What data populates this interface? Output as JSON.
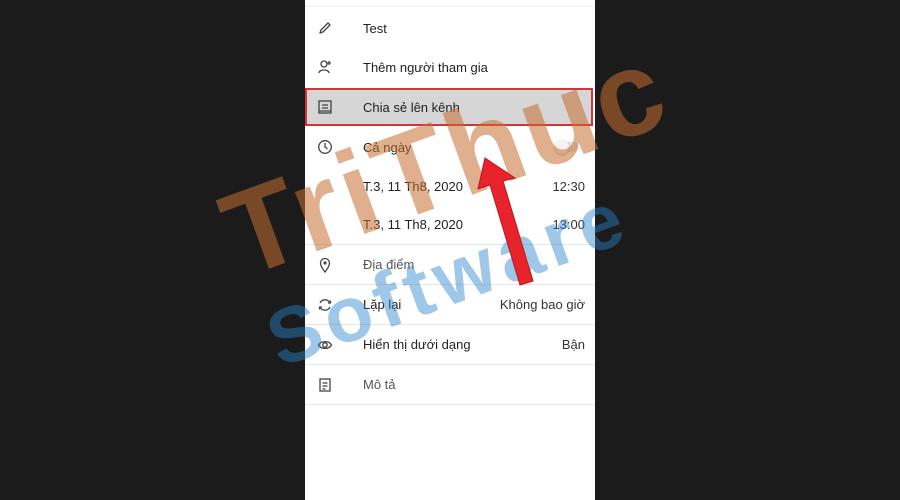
{
  "event": {
    "title": "Test",
    "add_participants_label": "Thêm người tham gia",
    "share_channel_label": "Chia sẻ lên kênh",
    "all_day_label": "Cả ngày",
    "all_day_on": false,
    "start": {
      "date": "T.3, 11 Th8, 2020",
      "time": "12:30"
    },
    "end": {
      "date": "T.3, 11 Th8, 2020",
      "time": "13:00"
    },
    "location_placeholder": "Địa điểm",
    "repeat_label": "Lặp lại",
    "repeat_value": "Không bao giờ",
    "show_as_label": "Hiển thị dưới dạng",
    "show_as_value": "Bận",
    "description_placeholder": "Mô tả"
  },
  "watermark": {
    "line1": "TriThuc",
    "line2": "Software",
    "color1": "#c46e32",
    "color2": "#2882cd"
  },
  "highlight_color": "#d5323a",
  "arrow_color": "#e8232b",
  "icons": [
    "pencil-icon",
    "add-person-icon",
    "channel-icon",
    "clock-icon",
    "location-pin-icon",
    "repeat-icon",
    "eye-icon",
    "note-icon"
  ]
}
